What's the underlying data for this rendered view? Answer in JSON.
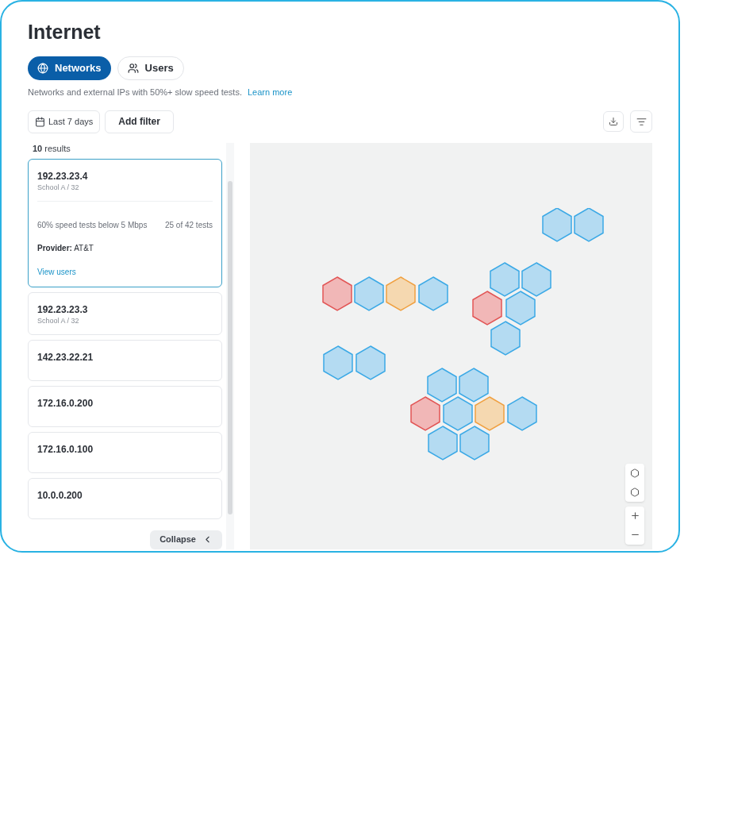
{
  "title": "Internet",
  "tabs": [
    {
      "label": "Networks",
      "kind": "globe",
      "selected": true
    },
    {
      "label": "Users",
      "kind": "users",
      "selected": false
    }
  ],
  "description": "Networks and external IPs with 50%+ slow speed tests.",
  "learn_more": "Learn more",
  "filters": {
    "date": "Last 7 days",
    "add": "Add filter"
  },
  "results_count": "10",
  "results_label": "results",
  "networks": [
    {
      "ip": "192.23.23.4",
      "subtitle": "School A / 32",
      "selected": true,
      "stat": "60% speed tests below 5 Mbps",
      "tests": "25 of 42 tests",
      "provider_label": "Provider:",
      "provider": "AT&T",
      "link": "View users"
    },
    {
      "ip": "192.23.23.3",
      "subtitle": "School A / 32",
      "selected": false
    },
    {
      "ip": "142.23.22.21",
      "selected": false
    },
    {
      "ip": "172.16.0.200",
      "selected": false
    },
    {
      "ip": "172.16.0.100",
      "selected": false
    },
    {
      "ip": "10.0.0.200",
      "selected": false
    }
  ],
  "collapse": "Collapse"
}
